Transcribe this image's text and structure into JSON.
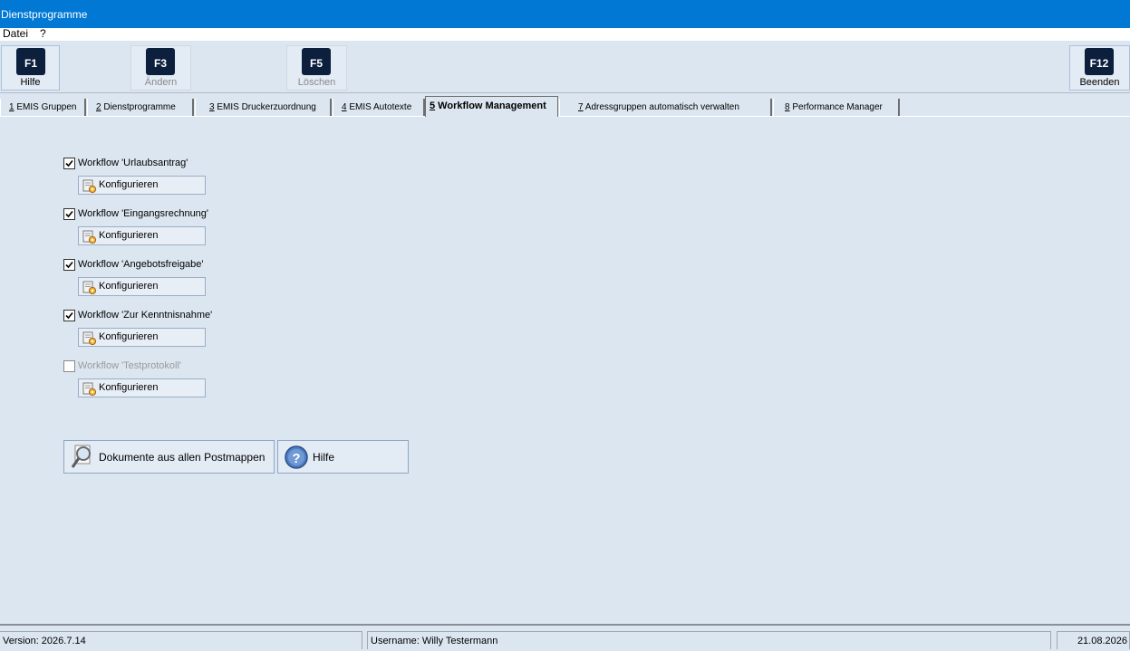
{
  "window": {
    "title": "Dienstprogramme"
  },
  "menu": {
    "items": [
      "Datei",
      "?"
    ]
  },
  "toolbar": {
    "help": {
      "key": "F1",
      "label": "Hilfe"
    },
    "edit": {
      "key": "F3",
      "label": "Ändern"
    },
    "delete": {
      "key": "F5",
      "label": "Löschen"
    },
    "exit": {
      "key": "F12",
      "label": "Beenden"
    }
  },
  "tabs": [
    {
      "num": "1",
      "label": " EMIS Gruppen"
    },
    {
      "num": "2",
      "label": " Dienstprogramme"
    },
    {
      "num": "3",
      "label": " EMIS Druckerzuordnung"
    },
    {
      "num": "4",
      "label": " EMIS Autotexte"
    },
    {
      "num": "5",
      "label": " Workflow Management"
    },
    {
      "num": "7",
      "label": " Adressgruppen automatisch verwalten"
    },
    {
      "num": "8",
      "label": " Performance Manager"
    }
  ],
  "workflows": [
    {
      "label": "Workflow 'Urlaubsantrag'",
      "checked": true,
      "enabled": true,
      "button": "Konfigurieren"
    },
    {
      "label": "Workflow 'Eingangsrechnung'",
      "checked": true,
      "enabled": true,
      "button": "Konfigurieren"
    },
    {
      "label": "Workflow 'Angebotsfreigabe'",
      "checked": true,
      "enabled": true,
      "button": "Konfigurieren"
    },
    {
      "label": "Workflow 'Zur Kenntnisnahme'",
      "checked": true,
      "enabled": true,
      "button": "Konfigurieren"
    },
    {
      "label": "Workflow 'Testprotokoll'",
      "checked": false,
      "enabled": false,
      "button": "Konfigurieren"
    }
  ],
  "actions": {
    "documents": "Dokumente aus allen Postmappen",
    "help": "Hilfe"
  },
  "statusbar": {
    "version": "Version: 2026.7.14",
    "user": "Username: Willy Testermann",
    "date": "21.08.2026"
  }
}
